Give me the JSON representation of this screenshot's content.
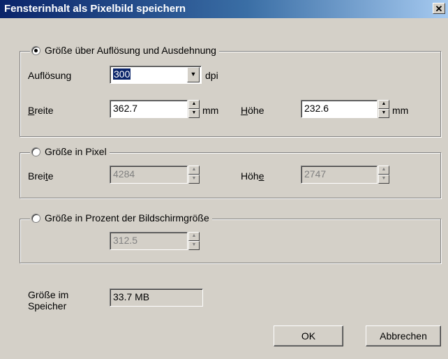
{
  "window": {
    "title": "Fensterinhalt als Pixelbild speichern",
    "close_glyph": "✕"
  },
  "group_resolution": {
    "legend": "Größe über Auflösung und Ausdehnung",
    "selected": true,
    "resolution_label": "Auflösung",
    "resolution_value": "300",
    "resolution_unit": "dpi",
    "width_label_rest": "reite",
    "width_label_mnemonic": "B",
    "width_value": "362.7",
    "width_unit": "mm",
    "height_label_rest": "öhe",
    "height_label_mnemonic": "H",
    "height_value": "232.6",
    "height_unit": "mm"
  },
  "group_pixel": {
    "legend": "Größe in Pixel",
    "selected": false,
    "width_label_pre": "Brei",
    "width_label_mnemonic": "t",
    "width_label_post": "e",
    "width_value": "4284",
    "height_label_pre": "Höh",
    "height_label_mnemonic": "e",
    "height_value": "2747"
  },
  "group_percent": {
    "legend": "Größe in Prozent der Bildschirmgröße",
    "selected": false,
    "value": "312.5"
  },
  "memory": {
    "label_line1": "Größe im",
    "label_line2": "Speicher",
    "value": "33.7 MB"
  },
  "buttons": {
    "ok": "OK",
    "cancel": "Abbrechen"
  },
  "icons": {
    "dropdown": "chevron-down-icon",
    "spin_up": "spin-up-icon",
    "spin_down": "spin-down-icon"
  }
}
